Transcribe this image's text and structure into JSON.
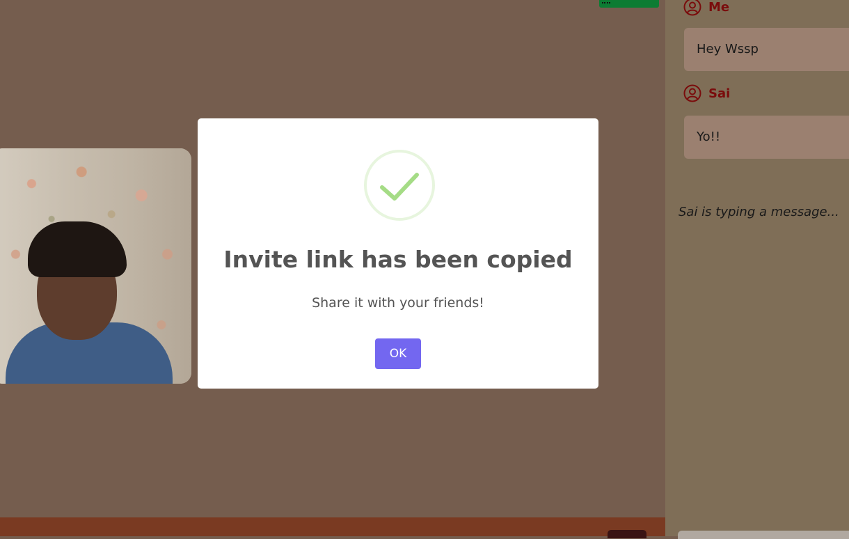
{
  "modal": {
    "title": "Invite link has been copied",
    "text": "Share it with your friends!",
    "ok_label": "OK",
    "icon": "checkmark-icon",
    "accent": "#7367f0",
    "check_color": "#a5dc86"
  },
  "chat": {
    "messages": [
      {
        "sender": "Me",
        "text": "Hey Wssp"
      },
      {
        "sender": "Sai",
        "text": "Yo!!"
      }
    ],
    "typing_indicator": "Sai is typing a message..."
  },
  "colors": {
    "background": "#755d4e",
    "chat_panel": "#7f6e57",
    "sender_name": "#7a0c0c",
    "bottom_bar": "#7a3a22"
  }
}
